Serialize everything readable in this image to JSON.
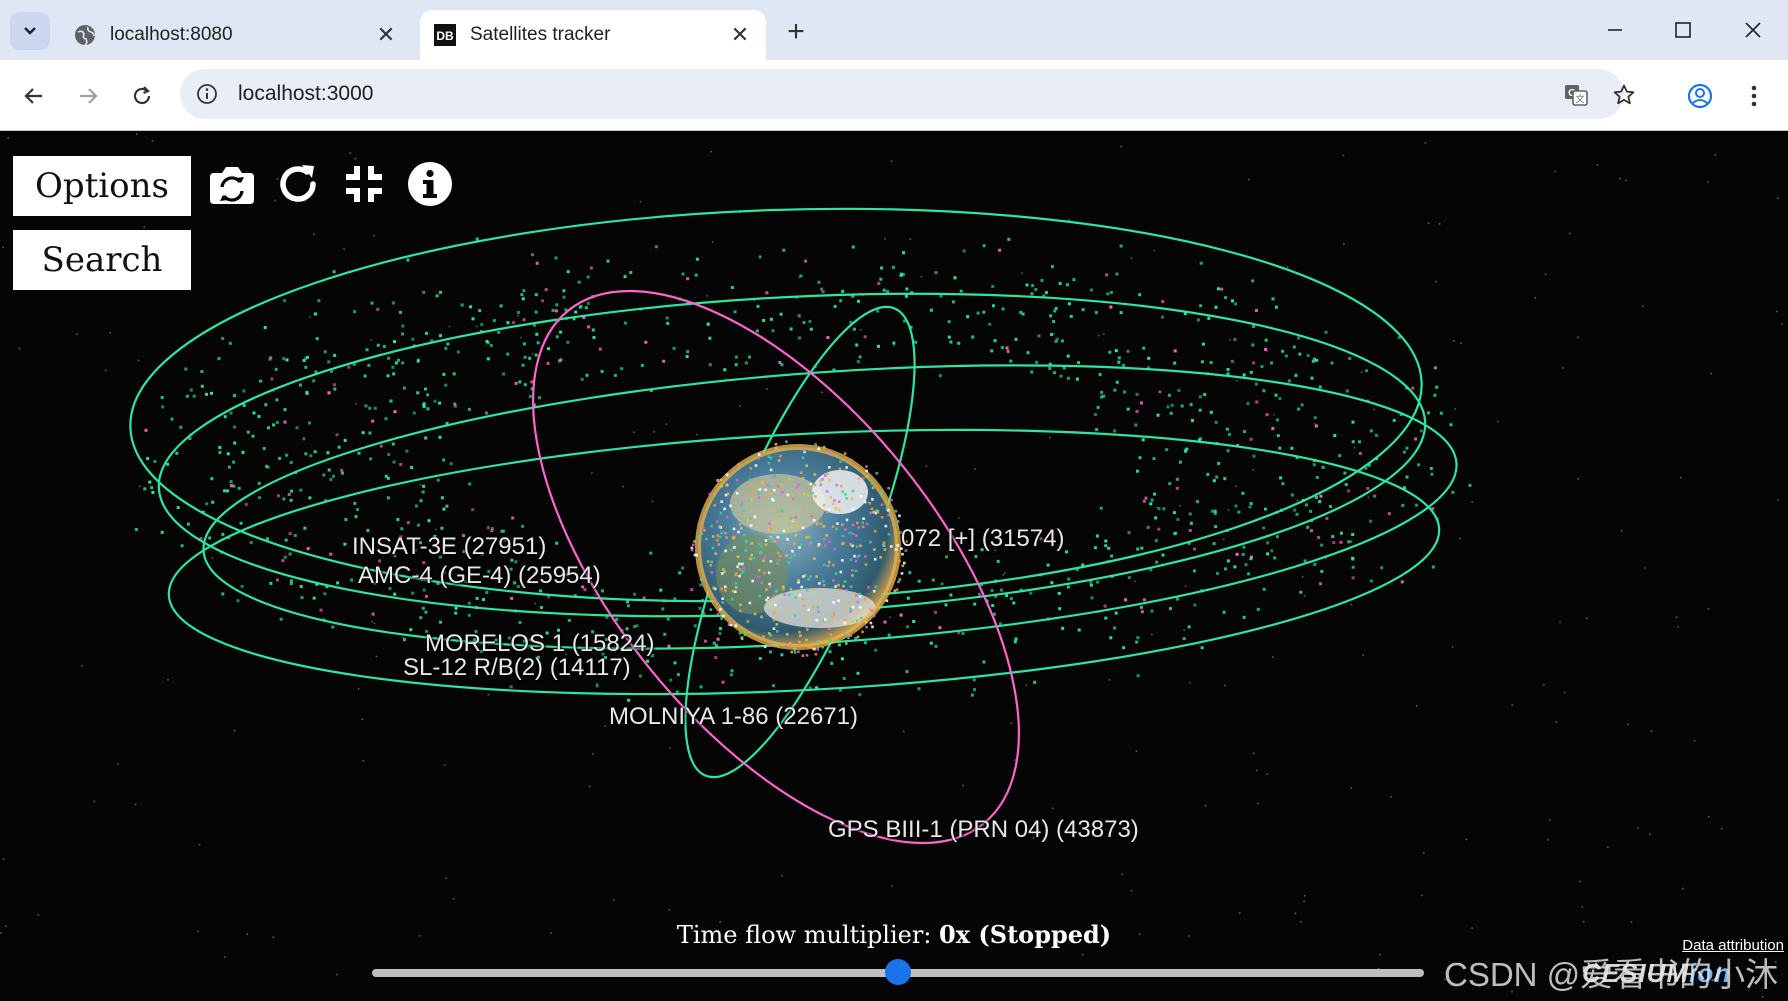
{
  "browser": {
    "tabs": [
      {
        "title": "localhost:8080",
        "active": false,
        "favicon": "globe-icon"
      },
      {
        "title": "Satellites tracker",
        "active": true,
        "favicon": "DB"
      }
    ],
    "url": "localhost:3000"
  },
  "app": {
    "options_label": "Options",
    "search_label": "Search",
    "toolbar_icons": [
      "camera-switch-icon",
      "refresh-icon",
      "collapse-icon",
      "info-icon"
    ]
  },
  "satellites": [
    {
      "label": "INSAT-3E (27951)"
    },
    {
      "label": "AMC-4 (GE-4) (25954)"
    },
    {
      "label": "072 [+] (31574)"
    },
    {
      "label": "MORELOS 1 (15824)"
    },
    {
      "label": "SL-12 R/B(2) (14117)"
    },
    {
      "label": "MOLNIYA 1-86 (22671)"
    },
    {
      "label": "GPS BIII-1  (PRN 04) (43873)"
    }
  ],
  "time_flow": {
    "prefix": "Time flow multiplier: ",
    "value": "0x (Stopped)",
    "slider_position": 0.5
  },
  "footer": {
    "attribution": "Data attribution",
    "logo_main": "CESIUM",
    "logo_suffix": "ion",
    "watermark": "CSDN @爱看书的小沐"
  },
  "colors": {
    "orbit_green": "#2ee6a0",
    "orbit_pink": "#ff66cc",
    "slider_thumb": "#1a73e8"
  }
}
